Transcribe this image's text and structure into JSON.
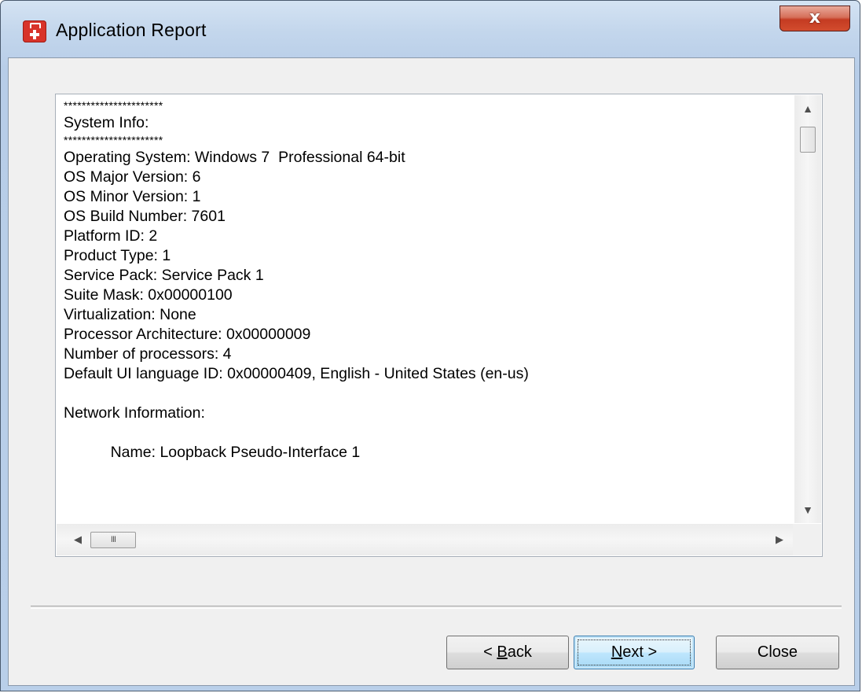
{
  "window": {
    "title": "Application Report",
    "close_glyph": "x"
  },
  "report": {
    "lines": [
      "**********************",
      "System Info:",
      "**********************",
      "Operating System: Windows 7  Professional 64-bit",
      "OS Major Version: 6",
      "OS Minor Version: 1",
      "OS Build Number: 7601",
      "Platform ID: 2",
      "Product Type: 1",
      "Service Pack: Service Pack 1",
      "Suite Mask: 0x00000100",
      "Virtualization: None",
      "Processor Architecture: 0x00000009",
      "Number of processors: 4",
      "Default UI language ID: 0x00000409, English - United States (en-us)",
      "",
      "Network Information:",
      "",
      "           Name: Loopback Pseudo-Interface 1"
    ],
    "hscroll_thumb_grip": "III"
  },
  "buttons": {
    "back_prefix": "< ",
    "back_mnemonic": "B",
    "back_rest": "ack",
    "next_mnemonic": "N",
    "next_rest": "ext >",
    "close": "Close"
  },
  "icons": {
    "app": "first-aid-kit-icon",
    "scroll_up": "arrow-up-icon",
    "scroll_down": "arrow-down-icon",
    "scroll_left": "arrow-left-icon",
    "scroll_right": "arrow-right-icon"
  },
  "colors": {
    "close_button": "#c43b22",
    "app_icon": "#d8332a",
    "default_button": "#3c7fb1"
  }
}
